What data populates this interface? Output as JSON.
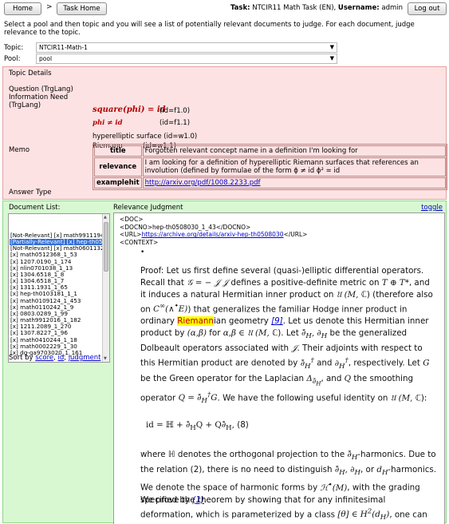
{
  "topbar": {
    "home": "Home",
    "separator": ">",
    "task_home": "Task Home",
    "task_label": "Task:",
    "task_value": "NTCIR11 Math Task (EN),",
    "username_label": "Username:",
    "username_value": "admin",
    "logout": "Log out"
  },
  "instructions": "Select a pool and then topic and you will see a list of potentially relevant documents to judge. For each document, judge relevance to the topic.",
  "topic_select": {
    "label": "Topic:",
    "value": "NTCIR11-Math-1"
  },
  "pool_select": {
    "label": "Pool:",
    "value": "pool"
  },
  "topic_details": {
    "title": "Topic Details",
    "question_label": "Question (TrgLang) Information Need (TrgLang)",
    "formulas": [
      {
        "expr": "square(phi) = id",
        "id": "(id=f1.0)"
      },
      {
        "expr": "phi ≠ id",
        "id": "(id=f1.1)"
      },
      {
        "expr": "hyperelliptic surface",
        "id": "(id=w1.0)"
      },
      {
        "expr": "Riemann",
        "id": "(id=w1.1)"
      }
    ],
    "memo_label": "Memo",
    "memo": {
      "title_key": "title",
      "title_value": "Forgotten relevant concept name in a definition I'm looking for",
      "relevance_key": "relevance",
      "relevance_value": "I am looking for a definition of hyperelliptic Riemann surfaces that references an involution (defined by formulae of the form ϕ ≠ id ϕ² = id",
      "examplehit_key": "examplehit",
      "examplehit_value": "http://arxiv.org/pdf/1008.2233.pdf"
    },
    "answer_type_label": "Answer Type"
  },
  "document_list": {
    "title": "Document List:",
    "items": [
      {
        "text": "[Not-Relevant] [x] math9911194",
        "selected": false
      },
      {
        "text": "[Partially-Relevant] [x] hep-th0508030_1_43",
        "selected": true
      },
      {
        "text": "[Not-Relevant] [x] math0601132",
        "selected": false
      },
      {
        "text": "[x] math0512368_1_53",
        "selected": false
      },
      {
        "text": "[x] 1207.0190_1_174",
        "selected": false
      },
      {
        "text": "[x] nlin0701038_1_13",
        "selected": false
      },
      {
        "text": "[x] 1304.6518_1_8",
        "selected": false
      },
      {
        "text": "[x] 1304.6518_1_7",
        "selected": false
      },
      {
        "text": "[x] 1311.1931_1_65",
        "selected": false
      },
      {
        "text": "[x] hep-th0103181_1_1",
        "selected": false
      },
      {
        "text": "[x] math0109124_1_453",
        "selected": false
      },
      {
        "text": "[x] math0110242_1_9",
        "selected": false
      },
      {
        "text": "[x] 0803.0289_1_99",
        "selected": false
      },
      {
        "text": "[x] math9912016_1_182",
        "selected": false
      },
      {
        "text": "[x] 1211.2089_1_270",
        "selected": false
      },
      {
        "text": "[x] 1307.8227_1_96",
        "selected": false
      },
      {
        "text": "[x] math0410244_1_18",
        "selected": false
      },
      {
        "text": "[x] math0002229_1_30",
        "selected": false
      },
      {
        "text": "[x] dg-ga9703020_1_161",
        "selected": false
      }
    ],
    "sort_prefix": "Sort by",
    "sort_score": "score",
    "sort_id": "id",
    "sort_judgment": "judgment"
  },
  "relevance": {
    "title": "Relevance Judgment",
    "toggle": "toggle",
    "doc_tag": "<DOC>",
    "docno_line": "<DOCNO>hep-th0508030_1_43</DOCNO>",
    "url_open": "<URL>",
    "url_link": "https://archive.org/details/arxiv-hep-th0508030",
    "url_close": "</URL>",
    "context_tag": "<CONTEXT>",
    "bullet": "•",
    "highlight_word": "Riemann"
  },
  "colors": {
    "topic_details_bg": "#fde2e3",
    "lower_panel_bg": "#d8f8d2",
    "selected_row_bg": "#3470d6",
    "formula_color": "#b20000",
    "link_color": "#0000cc",
    "highlight_bg": "#ffff00"
  }
}
